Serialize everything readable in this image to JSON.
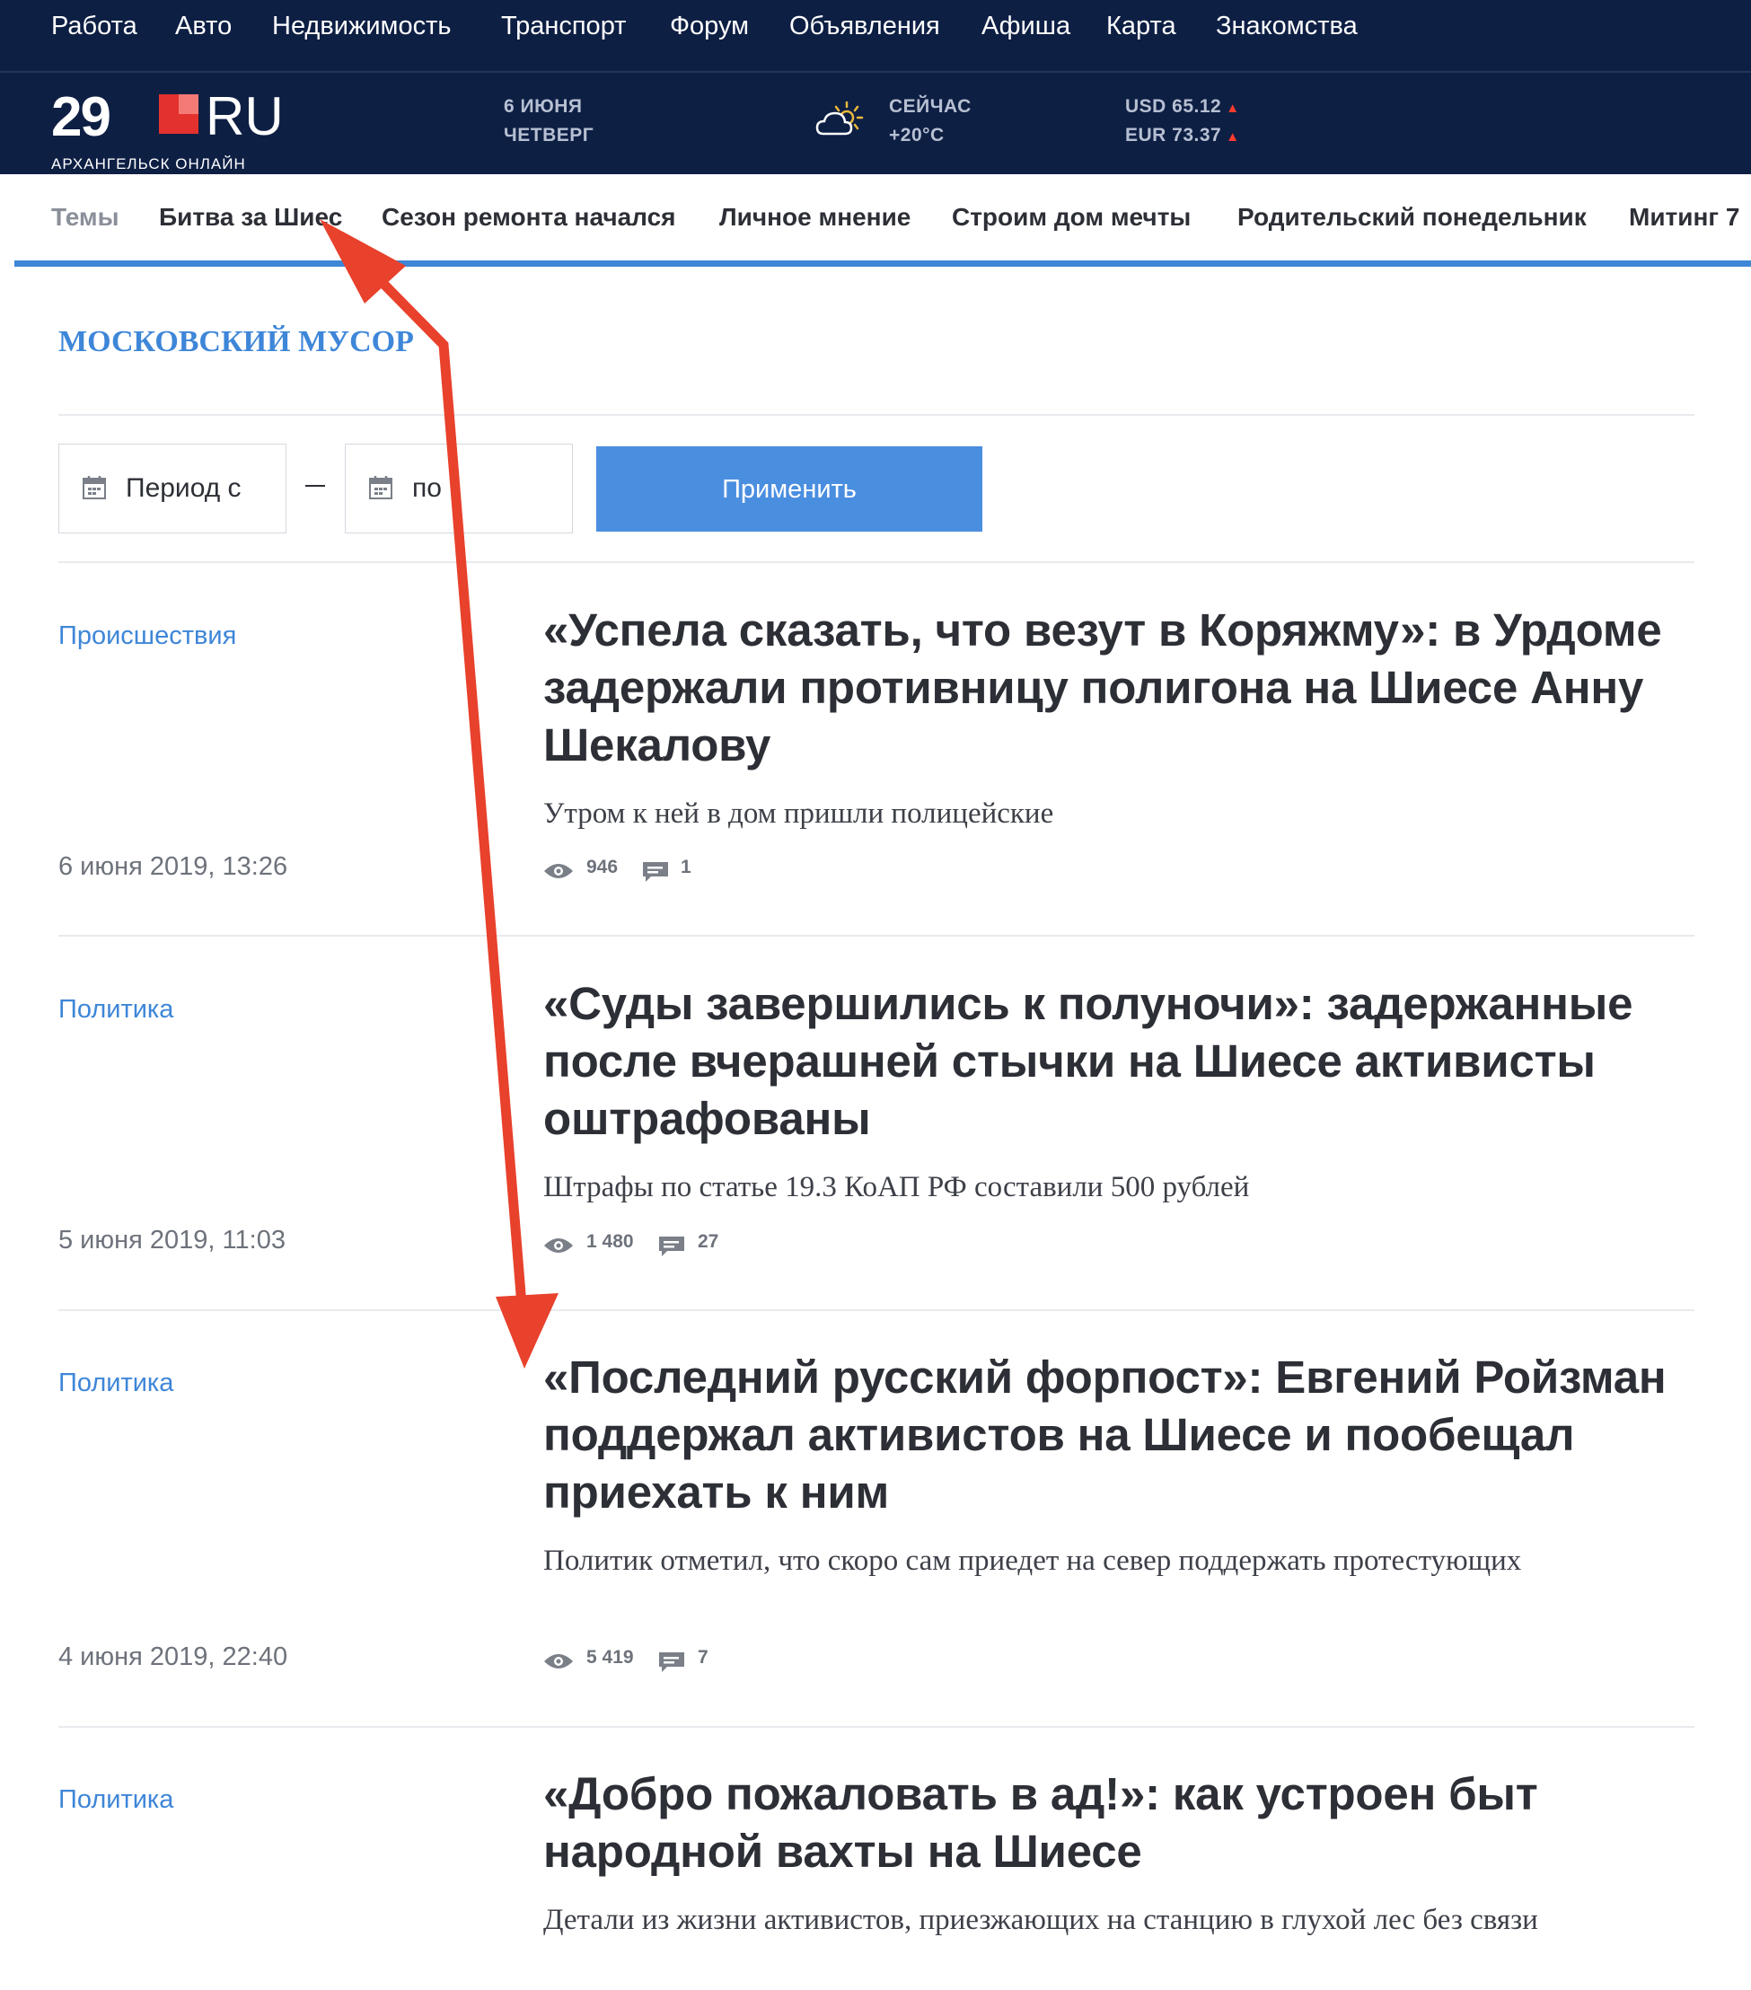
{
  "topnav": {
    "links": [
      "Работа",
      "Авто",
      "Недвижимость",
      "Транспорт",
      "Форум",
      "Объявления",
      "Афиша",
      "Карта",
      "Знакомства"
    ]
  },
  "brand": {
    "logo_number": "29",
    "logo_suffix": "RU",
    "logo_subtitle": "АРХАНГЕЛЬСК ОНЛАЙН",
    "date_line1": "6 ИЮНЯ",
    "date_line2": "ЧЕТВЕРГ",
    "weather_label": "СЕЙЧАС",
    "weather_temp": "+20°C",
    "usd": "USD 65.12",
    "eur": "EUR 73.37",
    "rate_up_symbol": "▲"
  },
  "themes": {
    "label": "Темы",
    "items": [
      "Битва за Шиес",
      "Сезон ремонта начался",
      "Личное мнение",
      "Строим дом мечты",
      "Родительский понедельник",
      "Митинг 7"
    ]
  },
  "section_title": "МОСКОВСКИЙ МУСОР",
  "filter": {
    "from_label": "Период с",
    "to_label": "по",
    "apply_label": "Применить"
  },
  "articles": [
    {
      "category": "Происшествия",
      "date": "6 июня 2019, 13:26",
      "title": "«Успела сказать, что везут в Коряжму»: в Урдоме задержали противницу полигона на Шиесе Анну Шекалову",
      "lead": "Утром к ней в дом пришли полицейские",
      "views": "946",
      "comments": "1"
    },
    {
      "category": "Политика",
      "date": "5 июня 2019, 11:03",
      "title": "«Суды завершились к полуночи»: задержанные после вчерашней стычки на Шиесе активисты оштрафованы",
      "lead": "Штрафы по статье 19.3 КоАП РФ составили 500 рублей",
      "views": "1 480",
      "comments": "27"
    },
    {
      "category": "Политика",
      "date": "4 июня 2019, 22:40",
      "title": "«Последний русский форпост»: Евгений Ройзман поддержал активистов на Шиесе и пообещал приехать к ним",
      "lead": "Политик отметил, что скоро сам приедет на север поддержать протестующих",
      "views": "5 419",
      "comments": "7"
    },
    {
      "category": "Политика",
      "date": "",
      "title": "«Добро пожаловать в ад!»: как устроен быт народной вахты на Шиесе",
      "lead": "Детали из жизни активистов, приезжающих на станцию в глухой лес без связи",
      "views": "",
      "comments": ""
    }
  ],
  "colors": {
    "navy": "#0e1f44",
    "accent_blue": "#3e86d8",
    "button_blue": "#4a8ee0",
    "logo_red": "#e3322d",
    "annotation_red": "#e8412c"
  }
}
